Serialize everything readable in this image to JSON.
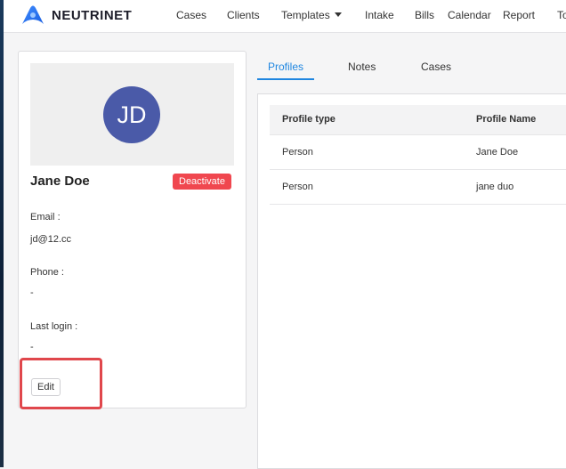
{
  "app": {
    "brand": "NEUTRINET",
    "accent_color": "#1f86e0"
  },
  "nav": {
    "items": [
      "Cases",
      "Clients",
      "Templates",
      "Intake",
      "Bills",
      "Calendar",
      "Report",
      "To"
    ]
  },
  "profile": {
    "initials": "JD",
    "name": "Jane Doe",
    "deactivate_label": "Deactivate",
    "email_label": "Email",
    "email_value": "jd@12.cc",
    "phone_label": "Phone",
    "phone_value": "-",
    "last_login_label": "Last login",
    "last_login_value": "-",
    "edit_label": "Edit"
  },
  "tabs": [
    "Profiles",
    "Notes",
    "Cases"
  ],
  "active_tab": "Profiles",
  "table": {
    "headers": [
      "Profile type",
      "Profile Name"
    ],
    "rows": [
      [
        "Person",
        "Jane Doe"
      ],
      [
        "Person",
        "jane duo"
      ]
    ]
  }
}
